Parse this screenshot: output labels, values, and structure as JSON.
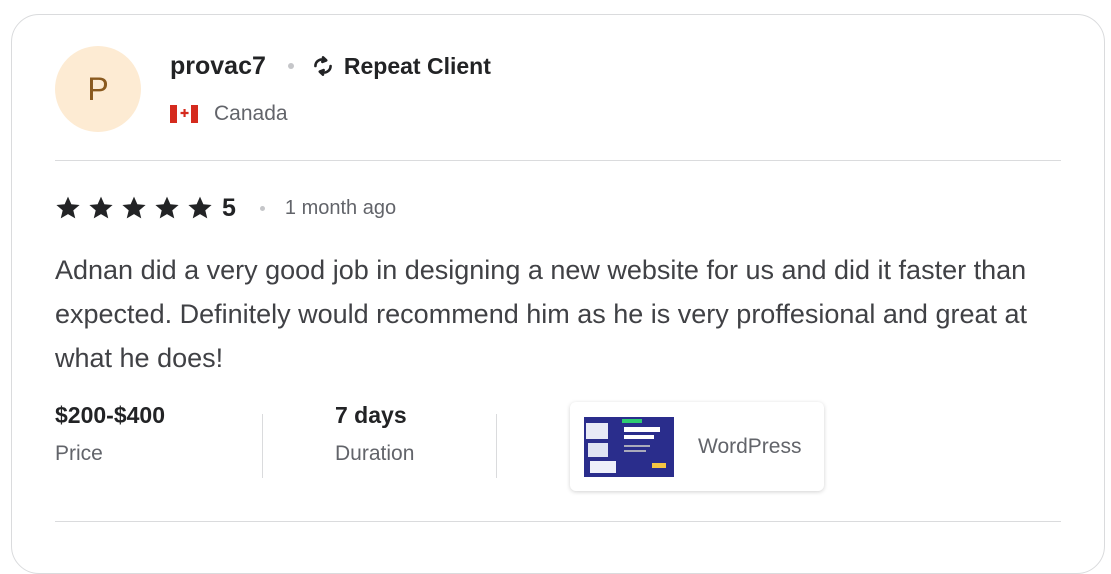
{
  "reviewer": {
    "avatar_initial": "P",
    "username": "provac7",
    "badge": "Repeat Client",
    "country": "Canada"
  },
  "review": {
    "rating_stars": 5,
    "rating_value": "5",
    "time_ago": "1 month ago",
    "text": "Adnan did a very good job in designing a new website for us and did it faster than expected. Definitely would recommend him as he is very proffesional and great at what he does!"
  },
  "stats": {
    "price_value": "$200-$400",
    "price_label": "Price",
    "duration_value": "7 days",
    "duration_label": "Duration"
  },
  "gig": {
    "name": "WordPress"
  },
  "colors": {
    "avatar_bg": "#fdebd3",
    "avatar_text": "#8a5a1f",
    "text_primary": "#222325",
    "text_secondary": "#62646a",
    "divider": "#dadbdd",
    "flag_red": "#d52b1e"
  },
  "icons": {
    "repeat": "repeat-icon",
    "star": "star-icon",
    "flag": "canada-flag-icon"
  }
}
